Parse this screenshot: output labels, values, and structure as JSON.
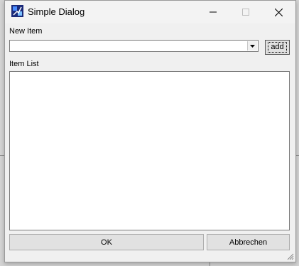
{
  "window": {
    "title": "Simple Dialog",
    "app_icon": "app-icon",
    "controls": [
      "minimize-icon",
      "maximize-icon",
      "close-icon"
    ]
  },
  "form": {
    "new_item_label": "New Item",
    "new_item_value": "",
    "add_label": "add",
    "item_list_label": "Item List",
    "items": []
  },
  "buttons": {
    "ok_label": "OK",
    "cancel_label": "Abbrechen"
  }
}
